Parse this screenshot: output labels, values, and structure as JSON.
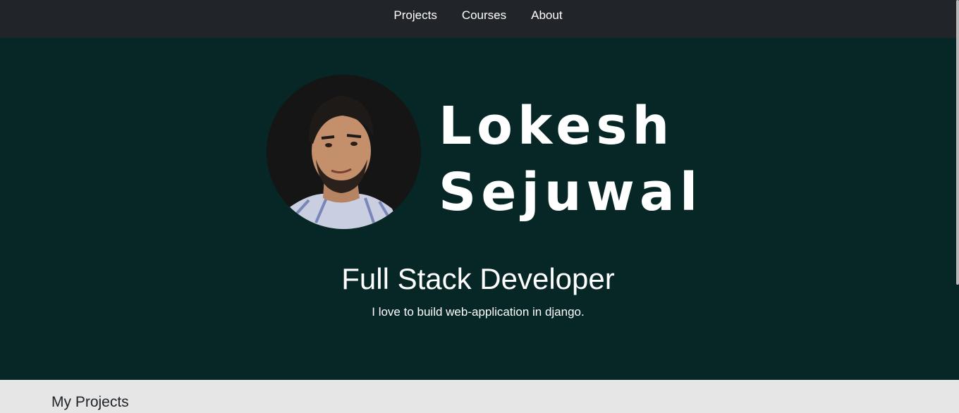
{
  "nav": {
    "items": [
      {
        "label": "Projects"
      },
      {
        "label": "Courses"
      },
      {
        "label": "About"
      }
    ]
  },
  "hero": {
    "name": "Lokesh\nSejuwal",
    "role": "Full Stack Developer",
    "tagline": "I love to build web-application in django."
  },
  "projects": {
    "heading": "My Projects"
  },
  "colors": {
    "navbar": "#21252a",
    "hero_background": "#072727",
    "page_background": "#e6e6e6",
    "text_light": "#ffffff"
  }
}
